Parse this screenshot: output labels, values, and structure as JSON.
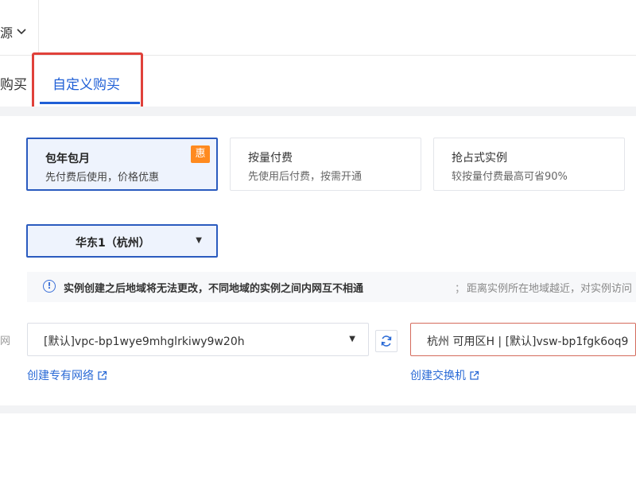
{
  "header": {
    "resource_label": "源",
    "chevron": "chevron-down-icon"
  },
  "tabs": [
    {
      "label": "购买",
      "active": false
    },
    {
      "label": "自定义购买",
      "active": true
    }
  ],
  "billing": [
    {
      "title": "包年包月",
      "desc": "先付费后使用，价格优惠",
      "badge": "惠",
      "selected": true
    },
    {
      "title": "按量付费",
      "desc": "先使用后付费，按需开通",
      "selected": false
    },
    {
      "title": "抢占式实例",
      "desc": "较按量付费最高可省90%",
      "selected": false
    }
  ],
  "region": {
    "value": "华东1（杭州）"
  },
  "notice": {
    "bold": "实例创建之后地域将无法更改，不同地域的实例之间内网互不相通",
    "separator": "；",
    "light": "距离实例所在地域越近，对实例访问"
  },
  "network": {
    "vpc_value": "[默认]vpc-bp1wye9mhglrkiwy9w20h",
    "vsw_value": "杭州 可用区H | [默认]vsw-bp1fgk6oq9",
    "create_vpc_link": "创建专有网络",
    "create_vsw_link": "创建交换机"
  },
  "colors": {
    "accent": "#1f5fd6",
    "highlight": "#e0413a",
    "badge": "#ff8a1f"
  }
}
